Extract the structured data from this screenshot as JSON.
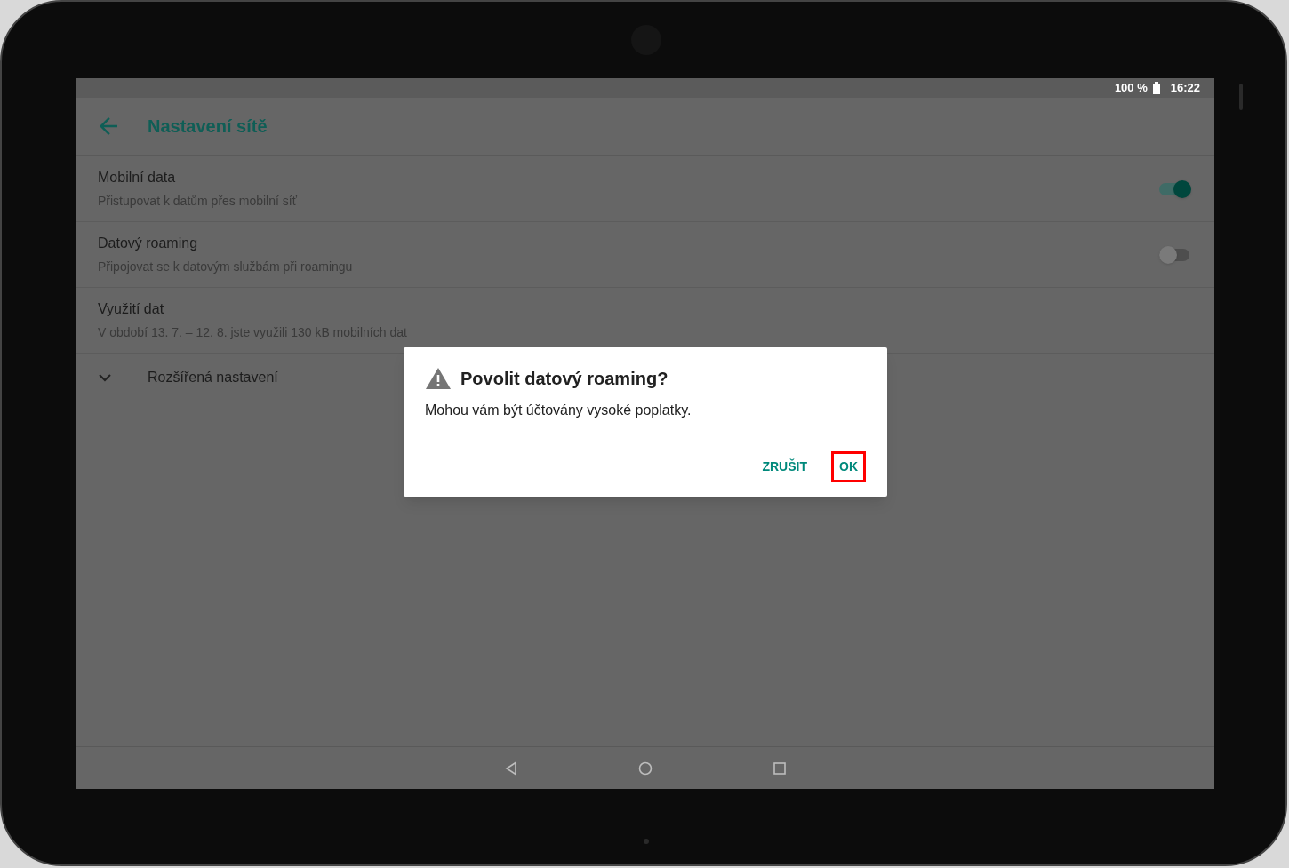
{
  "status_bar": {
    "battery": "100 %",
    "time": "16:22"
  },
  "app_bar": {
    "title": "Nastavení sítě"
  },
  "settings": [
    {
      "kind": "toggle",
      "title": "Mobilní data",
      "summary": "Přistupovat k datům přes mobilní síť",
      "on": true
    },
    {
      "kind": "toggle",
      "title": "Datový roaming",
      "summary": "Připojovat se k datovým službám při roamingu",
      "on": false
    },
    {
      "kind": "plain",
      "title": "Využití dat",
      "summary": "V období 13. 7. – 12. 8. jste využili 130 kB mobilních dat"
    },
    {
      "kind": "expander",
      "title": "Rozšířená nastavení",
      "expanded": false
    }
  ],
  "dialog": {
    "title": "Povolit datový roaming?",
    "message": "Mohou vám být účtovány vysoké poplatky.",
    "buttons": [
      {
        "label": "ZRUŠIT",
        "highlighted": false
      },
      {
        "label": "OK",
        "highlighted": true
      }
    ]
  }
}
